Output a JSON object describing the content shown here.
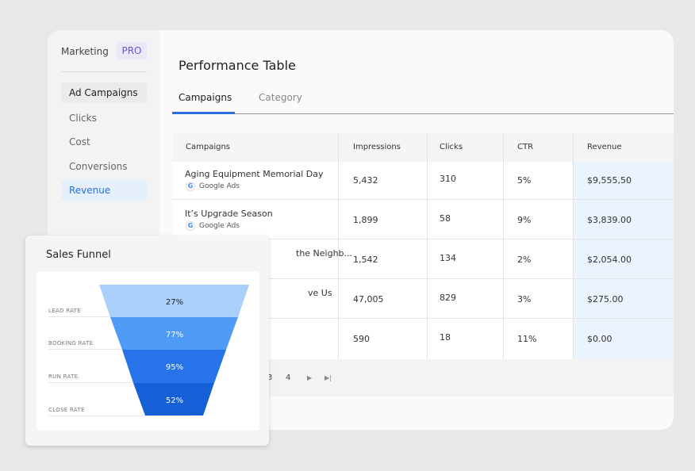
{
  "sidebar": {
    "brand": "Marketing",
    "badge": "PRO",
    "items": [
      {
        "label": "Ad Campaigns"
      },
      {
        "label": "Clicks"
      },
      {
        "label": "Cost"
      },
      {
        "label": "Conversions"
      },
      {
        "label": "Revenue"
      }
    ]
  },
  "header": {
    "title": "Performance Table"
  },
  "tabs": [
    {
      "label": "Campaigns"
    },
    {
      "label": "Category"
    }
  ],
  "table": {
    "columns": [
      "Campaigns",
      "Impressions",
      "Clicks",
      "CTR",
      "Revenue"
    ],
    "rows": [
      {
        "name": "Aging Equipment Memorial Day",
        "source": "Google Ads",
        "impressions": "5,432",
        "clicks": "310",
        "ctr": "5%",
        "revenue": "$9,555,50"
      },
      {
        "name": "It’s Upgrade Season",
        "source": "Google Ads",
        "impressions": "1,899",
        "clicks": "58",
        "ctr": "9%",
        "revenue": "$3,839.00"
      },
      {
        "name": "the Neighb...",
        "source": "",
        "impressions": "1,542",
        "clicks": "134",
        "ctr": "2%",
        "revenue": "$2,054.00"
      },
      {
        "name": "ve Us",
        "source": "",
        "impressions": "47,005",
        "clicks": "829",
        "ctr": "3%",
        "revenue": "$275.00"
      },
      {
        "name": "",
        "source": "",
        "impressions": "590",
        "clicks": "18",
        "ctr": "11%",
        "revenue": "$0.00"
      }
    ]
  },
  "pagination": {
    "pages": [
      "3",
      "4"
    ]
  },
  "funnel": {
    "title": "Sales Funnel",
    "stages": [
      {
        "label": "LEAD RATE",
        "value": "27%",
        "color": "#a9d0fb"
      },
      {
        "label": "BOOKING RATE",
        "value": "77%",
        "color": "#4f9bf6"
      },
      {
        "label": "RUN RATE",
        "value": "95%",
        "color": "#2774ea"
      },
      {
        "label": "CLOSE RATE",
        "value": "52%",
        "color": "#1560d6"
      }
    ]
  }
}
